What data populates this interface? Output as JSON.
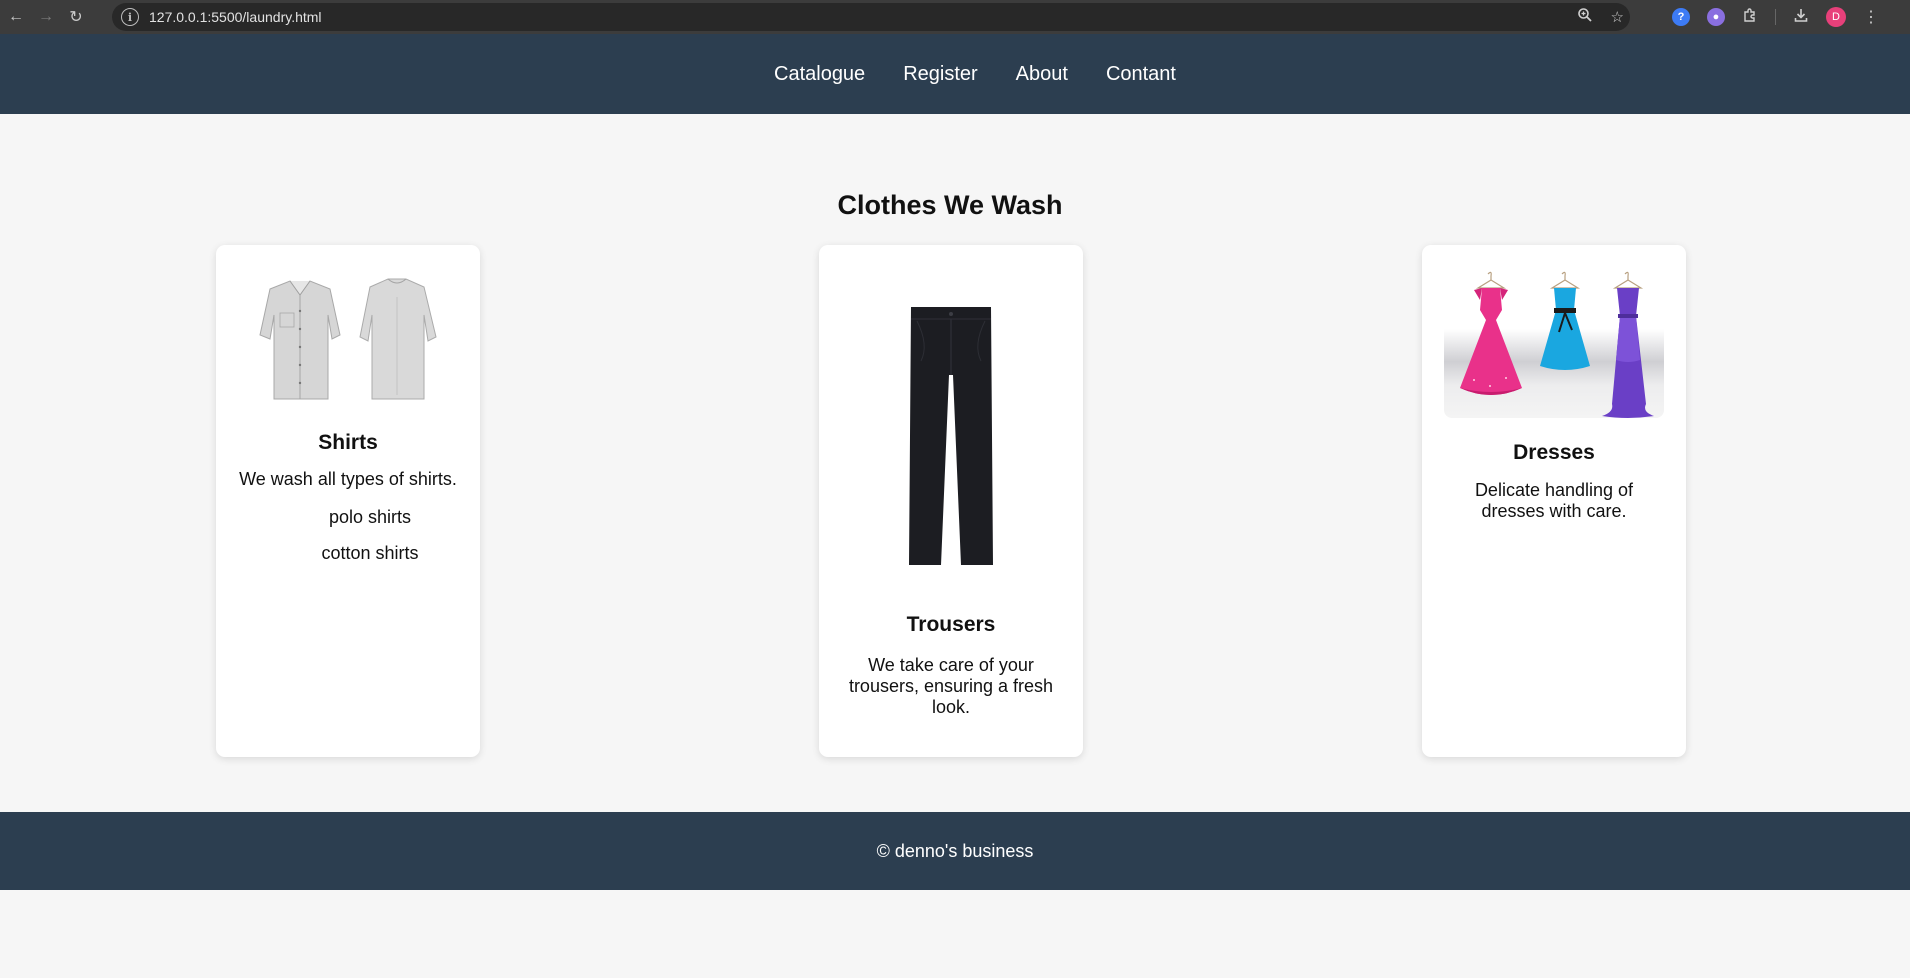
{
  "browser": {
    "url": "127.0.0.1:5500/laundry.html",
    "back_icon": "arrow-left-icon",
    "forward_icon": "arrow-right-icon",
    "reload_icon": "reload-icon",
    "avatar_letter": "D"
  },
  "nav": {
    "items": [
      {
        "label": "Catalogue"
      },
      {
        "label": "Register"
      },
      {
        "label": "About"
      },
      {
        "label": "Contant"
      }
    ]
  },
  "main": {
    "title": "Clothes We Wash",
    "cards": [
      {
        "title": "Shirts",
        "description": "We wash all types of shirts.",
        "list": [
          "polo shirts",
          "cotton shirts"
        ]
      },
      {
        "title": "Trousers",
        "description": "We take care of your trousers, ensuring a fresh look."
      },
      {
        "title": "Dresses",
        "description": "Delicate handling of dresses with care."
      }
    ]
  },
  "footer": {
    "text": "© denno's business"
  },
  "colors": {
    "header_bg": "#2c3e50",
    "page_bg": "#f6f6f6",
    "card_bg": "#ffffff"
  }
}
